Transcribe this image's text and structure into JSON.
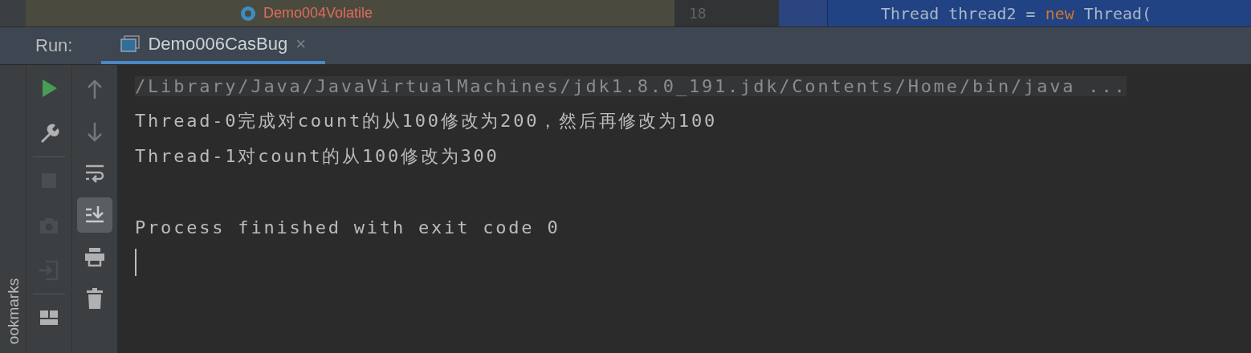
{
  "project_tree": {
    "item": "Demo004Volatile"
  },
  "editor": {
    "line_number": "18",
    "code": [
      {
        "text": "Thread thread2 = ",
        "kind": "plain"
      },
      {
        "text": "new",
        "kind": "keyword"
      },
      {
        "text": " Thread(",
        "kind": "plain"
      }
    ]
  },
  "run_panel": {
    "label": "Run:",
    "tabs": [
      {
        "label": "Demo006CasBug",
        "selected": true,
        "close": "×"
      }
    ]
  },
  "side_strip": {
    "label": "ookmarks"
  },
  "toolbar": [
    {
      "disabled": false
    },
    {
      "disabled": false
    },
    {
      "disabled": true
    },
    {
      "disabled": true
    },
    {
      "disabled": true
    },
    {
      "disabled": false
    }
  ],
  "console_toolbar": [
    {
      "disabled": true,
      "selected": false
    },
    {
      "disabled": true,
      "selected": false
    },
    {
      "disabled": false,
      "selected": false
    },
    {
      "disabled": false,
      "selected": true
    },
    {
      "disabled": false,
      "selected": false
    },
    {
      "disabled": false,
      "selected": false
    }
  ],
  "console": [
    {
      "text": "/Library/Java/JavaVirtualMachines/jdk1.8.0_191.jdk/Contents/Home/bin/java ...",
      "kind": "command"
    },
    {
      "text": "Thread-0完成对count的从100修改为200，然后再修改为100",
      "kind": "output"
    },
    {
      "text": "Thread-1对count的从100修改为300",
      "kind": "output"
    },
    {
      "kind": "blank"
    },
    {
      "text": "Process finished with exit code 0",
      "kind": "output"
    }
  ]
}
